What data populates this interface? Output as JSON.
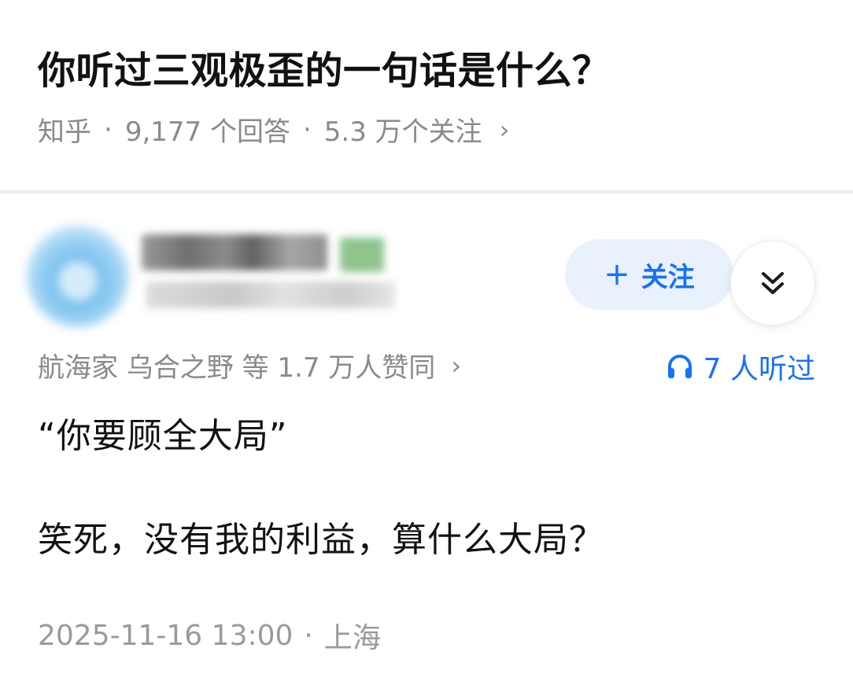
{
  "question": {
    "title": "你听过三观极歪的一句话是什么？",
    "source": "知乎",
    "answer_count": "9,177 个回答",
    "follower_count": "5.3 万个关注",
    "separator": "·",
    "chevron": "›"
  },
  "author": {
    "follow_label": "关注",
    "follow_icon": "plus-icon",
    "expand_icon": "double-chevron-down-icon"
  },
  "endorse": {
    "text": "航海家 乌合之野 等 1.7 万人赞同",
    "chevron": "›",
    "listened_text": "7 人听过",
    "listened_icon": "headphones-icon",
    "accent_color": "#1772f6"
  },
  "answer": {
    "paragraphs": [
      "“你要顾全大局”",
      "笑死，没有我的利益，算什么大局？"
    ],
    "date": "2025-11-16 13:00",
    "location": "上海",
    "separator": "·"
  }
}
